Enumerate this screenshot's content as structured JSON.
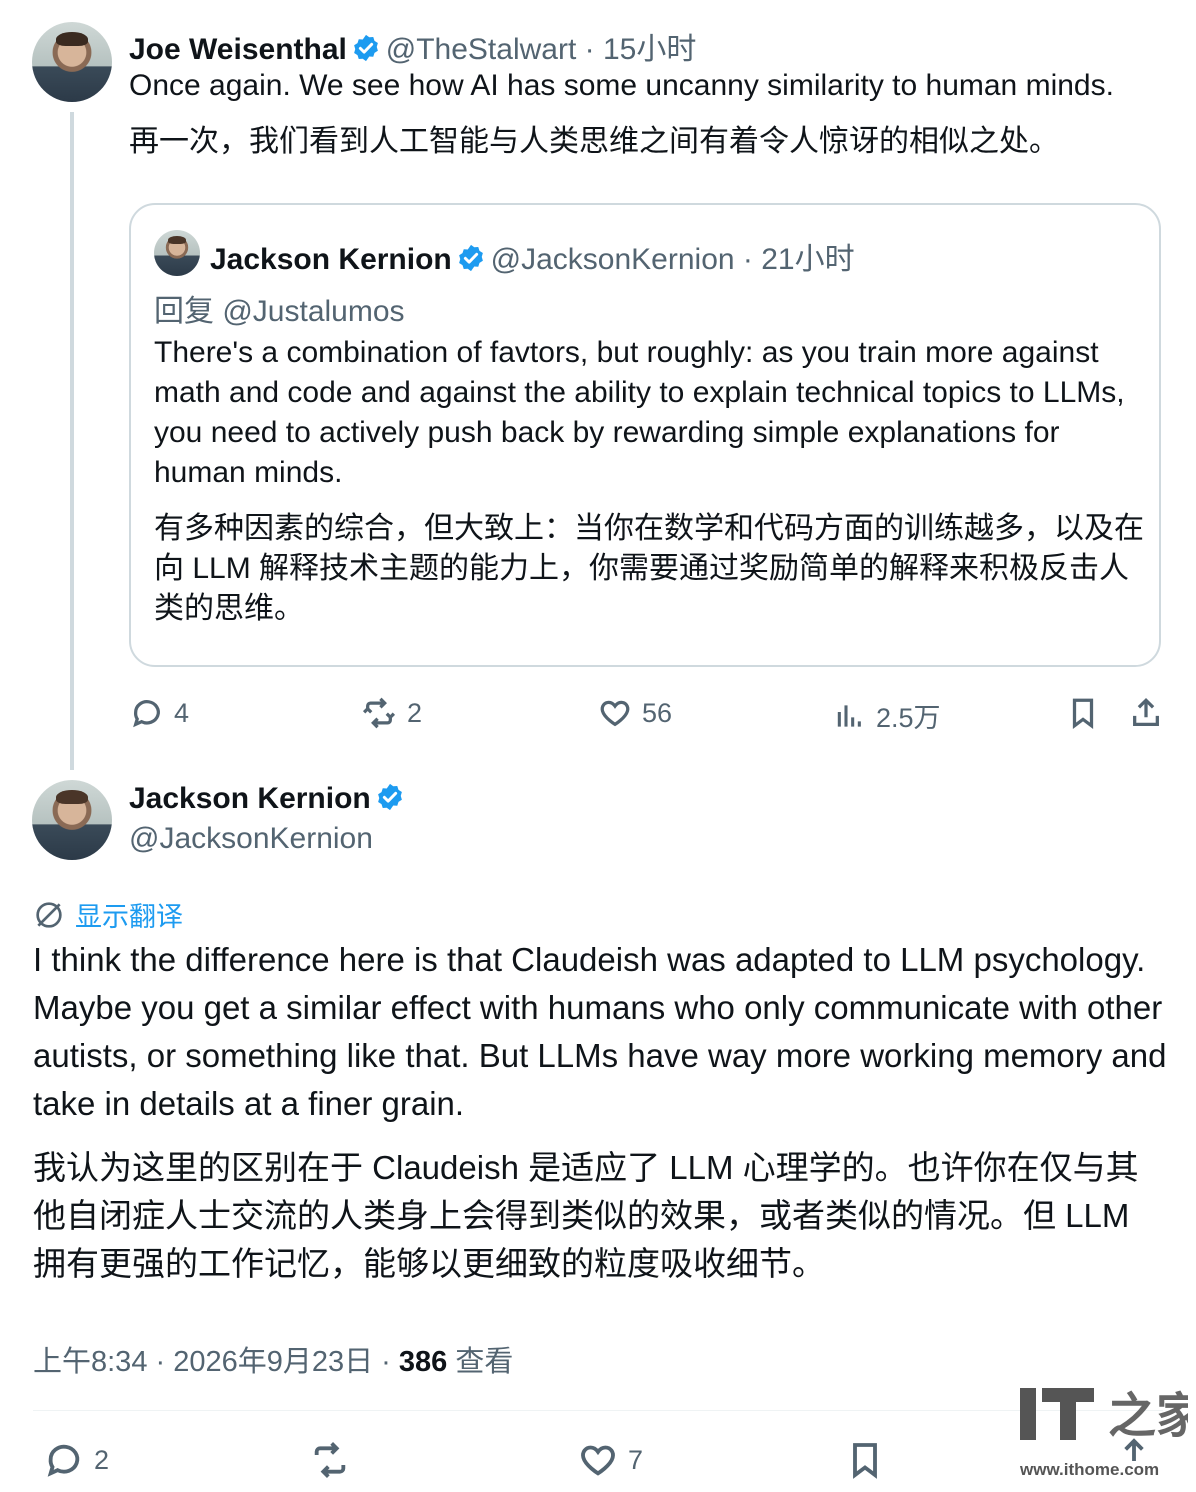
{
  "tweet1": {
    "name": "Joe Weisenthal",
    "handle": "@TheStalwart",
    "time": " · 15小时",
    "text": "Once again. We see how AI has some uncanny similarity to human minds.",
    "text_zh": "再一次，我们看到人工智能与人类思维之间有着令人惊讶的相似之处。",
    "actions": {
      "replies": "4",
      "retweets": "2",
      "likes": "56",
      "views": "2.5万"
    }
  },
  "quoted": {
    "name": "Jackson Kernion",
    "handle": "@JacksonKernion",
    "time": " · 21小时",
    "reply_prefix": "回复 ",
    "reply_to": "@Justalumos",
    "text": "There's a combination of favtors, but roughly: as you train more against math and code and against the ability to explain technical topics to LLMs, you need to actively push back by rewarding simple explanations for human minds.",
    "text_zh": "有多种因素的综合，但大致上：当你在数学和代码方面的训练越多，以及在向 LLM 解释技术主题的能力上，你需要通过奖励简单的解释来积极反击人类的思维。"
  },
  "tweet2": {
    "name": "Jackson Kernion",
    "handle": "@JacksonKernion",
    "translate_label": "显示翻译",
    "text": "I think the difference here is that Claudeish was adapted to LLM psychology. Maybe you get a similar effect with humans who only communicate with other autists, or something like that. But LLMs have way more working memory and take in details at a finer grain.",
    "text_zh": "我认为这里的区别在于 Claudeish 是适应了 LLM 心理学的。也许你在仅与其他自闭症人士交流的人类身上会得到类似的效果，或者类似的情况。但 LLM 拥有更强的工作记忆，能够以更细致的粒度吸收细节。",
    "timestamp": "上午8:34 · 2026年9月23日 · ",
    "views_count": "386",
    "views_label": " 查看",
    "actions": {
      "replies": "2",
      "likes": "7"
    }
  },
  "watermark": {
    "logo": "IT之家",
    "url": "www.ithome.com"
  },
  "colors": {
    "accent": "#1d9bf0",
    "muted": "#536471",
    "border": "#cfd9de"
  }
}
